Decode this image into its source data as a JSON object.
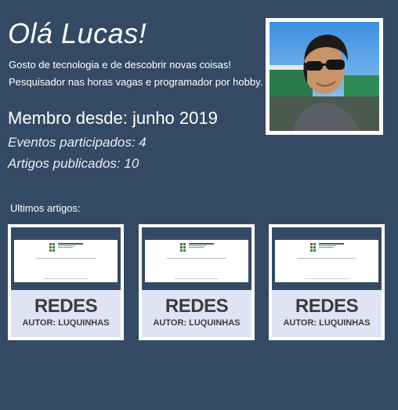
{
  "profile": {
    "greeting": "Olá Lucas!",
    "bio_lines": [
      "Gosto de tecnologia e de descobrir novas coisas!",
      "Pesquisador nas horas vagas e programador por hobby."
    ],
    "member_since": "Membro desde: junho 2019",
    "events": "Eventos participados: 4",
    "articles": "Artigos publicados: 10"
  },
  "section_title": "Ultimos artigos:",
  "articles": [
    {
      "title": "REDES",
      "author": "AUTOR: LUQUINHAS"
    },
    {
      "title": "REDES",
      "author": "AUTOR: LUQUINHAS"
    },
    {
      "title": "REDES",
      "author": "AUTOR: LUQUINHAS"
    }
  ],
  "colors": {
    "background": "#344a64",
    "card_label_bg": "#dfe4f5",
    "card_text": "#3c3c3c"
  }
}
